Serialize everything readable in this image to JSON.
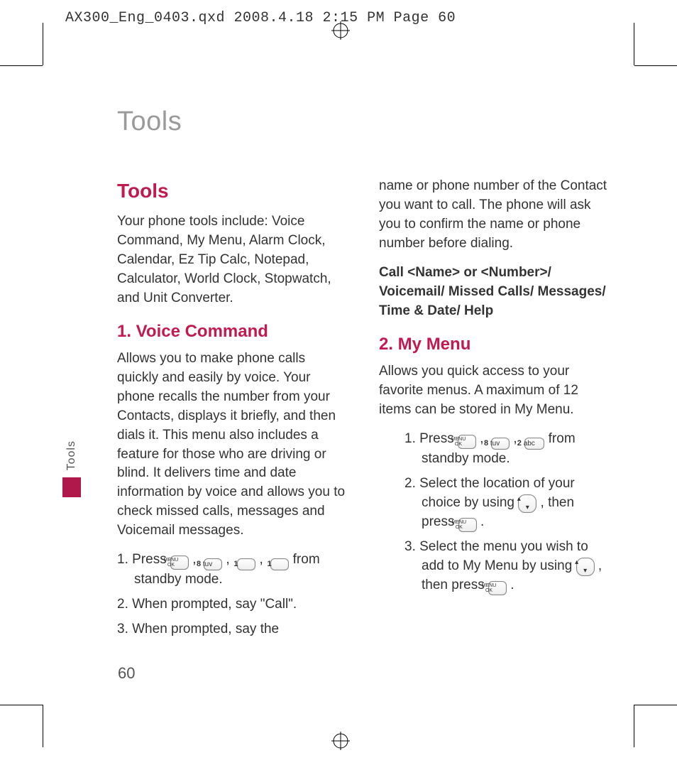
{
  "slug": "AX300_Eng_0403.qxd  2008.4.18  2:15 PM  Page 60",
  "side_tab": "Tools",
  "page_number": "60",
  "title_grey": "Tools",
  "col1": {
    "h_tools": "Tools",
    "intro": "Your phone tools include: Voice Command, My Menu, Alarm Clock, Calendar, Ez Tip Calc, Notepad, Calculator, World Clock, Stopwatch, and Unit Converter.",
    "h_voice": "1. Voice Command",
    "voice_body": "Allows you to make phone calls quickly and easily by voice. Your phone recalls the number from your Contacts, displays it briefly, and then dials it. This menu also includes a feature for those who are driving or blind. It delivers time and date information by voice and allows you to check missed calls, messages and Voicemail messages.",
    "steps": {
      "s1a": "1. Press ",
      "s1b": " from standby mode.",
      "s2": "2. When prompted, say \"Call\".",
      "s3": "3. When prompted, say the"
    }
  },
  "col2": {
    "cont": "name or phone number of the Contact you want to call. The phone will ask you to confirm the name or phone number before dialing.",
    "bold_block": "Call <Name> or <Number>/ Voicemail/ Missed Calls/ Messages/ Time & Date/ Help",
    "h_mymenu": "2. My Menu",
    "mymenu_body": "Allows you quick access to your favorite menus. A maximum of 12 items can be stored in My Menu.",
    "steps": {
      "s1a": "1. Press ",
      "s1b": " from standby mode.",
      "s2a": "2. Select the location of your choice by using ",
      "s2b": ", then press ",
      "s2c": " .",
      "s3a": "3. Select the menu you wish to add to My Menu by using ",
      "s3b": ", then press ",
      "s3c": " ."
    }
  },
  "keys": {
    "menu_ok_top": "MENU",
    "menu_ok_bot": "OK",
    "k8": "8",
    "k8sub": "tuv",
    "k1": "1",
    "k2": "2",
    "k2sub": "abc",
    "nav": "◦"
  }
}
